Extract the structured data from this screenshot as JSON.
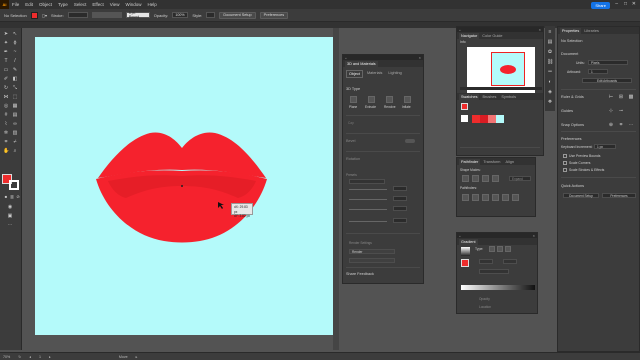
{
  "app": {
    "logo": "Ai",
    "share_label": "Share"
  },
  "menu": [
    "File",
    "Edit",
    "Object",
    "Type",
    "Select",
    "Effect",
    "View",
    "Window",
    "Help"
  ],
  "control_bar": {
    "selection": "No Selection",
    "fill_color": "#ee2c2c",
    "stroke_label": "Stroke:",
    "brush": "5 pt. Round",
    "opacity_label": "Opacity:",
    "opacity_value": "100%",
    "style_label": "Style:",
    "document_setup": "Document Setup",
    "preferences": "Preferences"
  },
  "canvas": {
    "artboard_color": "#b4fafa",
    "lips_color": "#f5222d",
    "lips_shadow_color": "#d91c23",
    "tooltip_line1": "dX: 29.83 px",
    "tooltip_line2": "dY: 3.82 px"
  },
  "appearance_panel": {
    "tabs": [
      "3D and Materials"
    ],
    "subtabs": [
      "Object",
      "Materials",
      "Lighting"
    ],
    "section_3d_type": "3D Type",
    "types": [
      "Plane",
      "Extrude",
      "Revolve",
      "Inflate"
    ],
    "rotation": "Rotation",
    "presets": "Presets",
    "bevel": "Bevel",
    "show_feedback": "Share Feedback",
    "render_label": "Render Settings",
    "render_button": "Render"
  },
  "navigator_panel": {
    "tabs": [
      "Navigator",
      "Color Guide"
    ],
    "subtab": "Info"
  },
  "swatches_panel": {
    "tabs": [
      "Swatches",
      "Brushes",
      "Symbols"
    ],
    "swatch_colors": [
      "#ffffff",
      "#ee2c2c",
      "#d91c23",
      "#f27474",
      "#b4fafa"
    ]
  },
  "pathfinder_panel": {
    "tabs": [
      "Pathfinder",
      "Transform",
      "Align"
    ],
    "shape_modes": "Shape Modes:",
    "pathfinders": "Pathfinders:",
    "expand": "Expand"
  },
  "gradient_panel": {
    "tabs": [
      "Gradient"
    ],
    "type_label": "Type:",
    "opacity_label": "Opacity",
    "location_label": "Location"
  },
  "properties_panel": {
    "tabs": [
      "Properties",
      "Libraries"
    ],
    "selection": "No Selection",
    "document": "Document",
    "units_label": "Units:",
    "units_value": "Pixels",
    "artboard_label": "Artboard:",
    "artboard_value": "1",
    "edit_artboards": "Edit Artboards",
    "rulers_grids": "Ruler & Grids",
    "guides": "Guides",
    "snap_options": "Snap Options",
    "preferences": "Preferences",
    "keyboard_increment_label": "Keyboard Increment:",
    "keyboard_increment_value": "1 px",
    "use_preview_bounds": "Use Preview Bounds",
    "scale_corners": "Scale Corners",
    "scale_strokes": "Scale Strokes & Effects",
    "quick_actions": "Quick Actions",
    "document_setup": "Document Setup",
    "preferences_btn": "Preferences"
  },
  "status_bar": {
    "zoom": "70%",
    "page": "1",
    "tool": "Move"
  }
}
